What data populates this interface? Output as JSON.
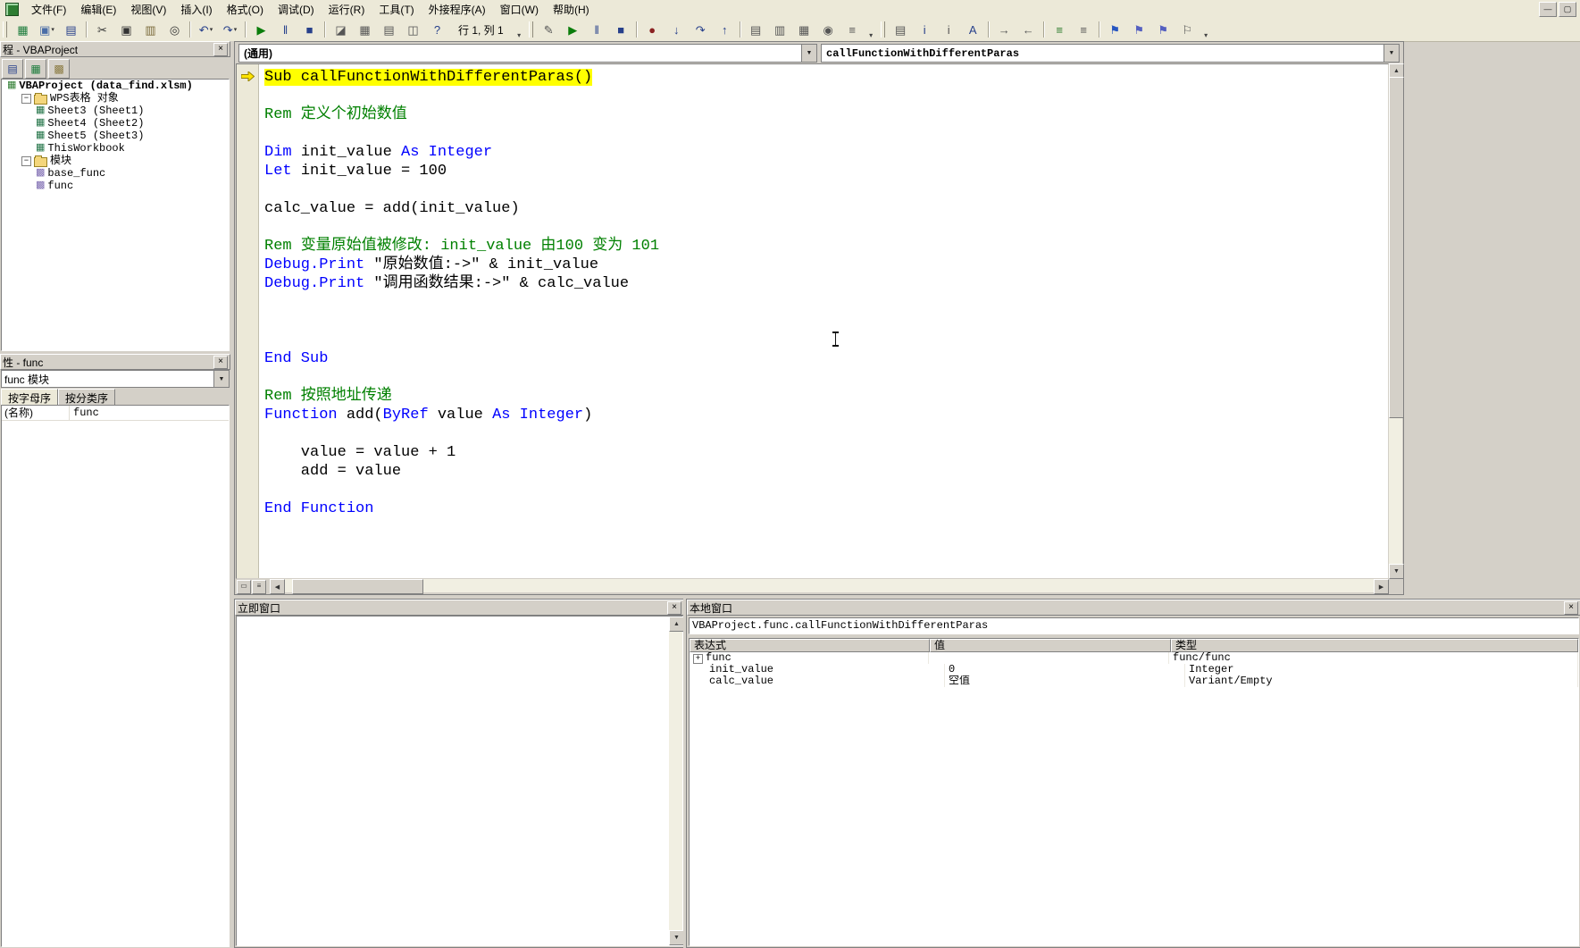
{
  "menu": {
    "items": [
      {
        "name": "menu-file",
        "label": "文件(F)"
      },
      {
        "name": "menu-edit",
        "label": "编辑(E)"
      },
      {
        "name": "menu-view",
        "label": "视图(V)"
      },
      {
        "name": "menu-insert",
        "label": "插入(I)"
      },
      {
        "name": "menu-format",
        "label": "格式(O)"
      },
      {
        "name": "menu-debug",
        "label": "调试(D)"
      },
      {
        "name": "menu-run",
        "label": "运行(R)"
      },
      {
        "name": "menu-tools",
        "label": "工具(T)"
      },
      {
        "name": "menu-addins",
        "label": "外接程序(A)"
      },
      {
        "name": "menu-window",
        "label": "窗口(W)"
      },
      {
        "name": "menu-help",
        "label": "帮助(H)"
      }
    ]
  },
  "window_controls": [
    {
      "name": "minimize-button",
      "glyph": "—"
    },
    {
      "name": "restore-button",
      "glyph": "▢"
    }
  ],
  "toolbar": {
    "groups": [
      {
        "name": "standard",
        "items": [
          {
            "k": "b",
            "name": "view-wps-button",
            "glyph": "▦",
            "color": "#1c7c3c"
          },
          {
            "k": "b",
            "name": "insert-userform-button",
            "glyph": "▣",
            "color": "#4a6da7",
            "dd": true
          },
          {
            "k": "b",
            "name": "save-button",
            "glyph": "▤",
            "color": "#27408b"
          },
          {
            "k": "s"
          },
          {
            "k": "b",
            "name": "cut-button",
            "glyph": "✂",
            "color": "#333333"
          },
          {
            "k": "b",
            "name": "copy-button",
            "glyph": "▣",
            "color": "#333333"
          },
          {
            "k": "b",
            "name": "paste-button",
            "glyph": "▥",
            "color": "#7a6a3a"
          },
          {
            "k": "b",
            "name": "find-button",
            "glyph": "◎",
            "color": "#333333"
          },
          {
            "k": "s"
          },
          {
            "k": "b",
            "name": "undo-button",
            "glyph": "↶",
            "color": "#27408b",
            "dd": true
          },
          {
            "k": "b",
            "name": "redo-button",
            "glyph": "↷",
            "color": "#27408b",
            "dd": true
          },
          {
            "k": "s"
          },
          {
            "k": "b",
            "name": "run-button",
            "glyph": "▶",
            "color": "#0b7d0b"
          },
          {
            "k": "b",
            "name": "break-button",
            "glyph": "‖",
            "color": "#27408b"
          },
          {
            "k": "b",
            "name": "reset-button",
            "glyph": "■",
            "color": "#27408b"
          },
          {
            "k": "s"
          },
          {
            "k": "b",
            "name": "design-mode-button",
            "glyph": "◪",
            "color": "#555555"
          },
          {
            "k": "b",
            "name": "project-explorer-button",
            "glyph": "▦",
            "color": "#555555"
          },
          {
            "k": "b",
            "name": "properties-window-button",
            "glyph": "▤",
            "color": "#555555"
          },
          {
            "k": "b",
            "name": "object-browser-button",
            "glyph": "◫",
            "color": "#555555"
          },
          {
            "k": "b",
            "name": "help-button",
            "glyph": "?",
            "color": "#27408b"
          },
          {
            "k": "t",
            "name": "line-col-indicator",
            "text": "行 1, 列 1"
          },
          {
            "k": "c"
          }
        ]
      },
      {
        "name": "debug",
        "items": [
          {
            "k": "b",
            "name": "debug-design-mode-button",
            "glyph": "✎",
            "color": "#555555"
          },
          {
            "k": "b",
            "name": "debug-run-button",
            "glyph": "▶",
            "color": "#0b7d0b"
          },
          {
            "k": "b",
            "name": "debug-break-button",
            "glyph": "‖",
            "color": "#27408b"
          },
          {
            "k": "b",
            "name": "debug-reset-button",
            "glyph": "■",
            "color": "#27408b"
          },
          {
            "k": "s"
          },
          {
            "k": "b",
            "name": "toggle-breakpoint-button",
            "glyph": "●",
            "color": "#8b2222"
          },
          {
            "k": "b",
            "name": "step-into-button",
            "glyph": "↓",
            "color": "#27408b"
          },
          {
            "k": "b",
            "name": "step-over-button",
            "glyph": "↷",
            "color": "#27408b"
          },
          {
            "k": "b",
            "name": "step-out-button",
            "glyph": "↑",
            "color": "#27408b"
          },
          {
            "k": "s"
          },
          {
            "k": "b",
            "name": "locals-window-button",
            "glyph": "▤",
            "color": "#555555"
          },
          {
            "k": "b",
            "name": "immediate-window-button",
            "glyph": "▥",
            "color": "#555555"
          },
          {
            "k": "b",
            "name": "watch-window-button",
            "glyph": "▦",
            "color": "#555555"
          },
          {
            "k": "b",
            "name": "quick-watch-button",
            "glyph": "◉",
            "color": "#555555"
          },
          {
            "k": "b",
            "name": "call-stack-button",
            "glyph": "≡",
            "color": "#555555"
          },
          {
            "k": "c"
          }
        ]
      },
      {
        "name": "edit",
        "items": [
          {
            "k": "b",
            "name": "list-properties-button",
            "glyph": "▤",
            "color": "#555555"
          },
          {
            "k": "b",
            "name": "quick-info-button",
            "glyph": "i",
            "color": "#27408b"
          },
          {
            "k": "b",
            "name": "parameter-info-button",
            "glyph": "i",
            "color": "#555555"
          },
          {
            "k": "b",
            "name": "complete-word-button",
            "glyph": "A",
            "color": "#27408b"
          },
          {
            "k": "s"
          },
          {
            "k": "b",
            "name": "indent-button",
            "glyph": "→",
            "color": "#555555"
          },
          {
            "k": "b",
            "name": "outdent-button",
            "glyph": "←",
            "color": "#555555"
          },
          {
            "k": "s"
          },
          {
            "k": "b",
            "name": "comment-block-button",
            "glyph": "≡",
            "color": "#2a7a2a"
          },
          {
            "k": "b",
            "name": "uncomment-block-button",
            "glyph": "≡",
            "color": "#555555"
          },
          {
            "k": "s"
          },
          {
            "k": "b",
            "name": "toggle-bookmark-button",
            "glyph": "⚑",
            "color": "#2756c0"
          },
          {
            "k": "b",
            "name": "next-bookmark-button",
            "glyph": "⚑",
            "color": "#5560c0"
          },
          {
            "k": "b",
            "name": "previous-bookmark-button",
            "glyph": "⚑",
            "color": "#5560c0"
          },
          {
            "k": "b",
            "name": "clear-bookmarks-button",
            "glyph": "⚐",
            "color": "#555555"
          },
          {
            "k": "c"
          }
        ]
      }
    ]
  },
  "project_panel": {
    "title": "程 - VBAProject",
    "buttons": [
      {
        "name": "view-code-button",
        "glyph": "▤",
        "color": "#27408b"
      },
      {
        "name": "view-object-button",
        "glyph": "▦",
        "color": "#1c7c3c"
      },
      {
        "name": "toggle-folders-button",
        "glyph": "▩",
        "color": "#8a7a40"
      }
    ],
    "tree": [
      {
        "name": "tree-item-vbaproject-root",
        "label": "VBAProject (data_find.xlsm)",
        "icon": "project",
        "level": 0,
        "bold": true
      },
      {
        "name": "tree-item-wps-objects-folder",
        "label": "WPS表格 对象",
        "icon": "folder",
        "level": 1,
        "expander": "-"
      },
      {
        "name": "tree-item-sheet3",
        "label": "Sheet3 (Sheet1)",
        "icon": "sheet",
        "level": 2
      },
      {
        "name": "tree-item-sheet4",
        "label": "Sheet4 (Sheet2)",
        "icon": "sheet",
        "level": 2
      },
      {
        "name": "tree-item-sheet5",
        "label": "Sheet5 (Sheet3)",
        "icon": "sheet",
        "level": 2
      },
      {
        "name": "tree-item-thisworkbook",
        "label": "ThisWorkbook",
        "icon": "sheet",
        "level": 2
      },
      {
        "name": "tree-item-modules-folder",
        "label": "模块",
        "icon": "folder",
        "level": 1,
        "expander": "-"
      },
      {
        "name": "tree-item-base-func",
        "label": "base_func",
        "icon": "module",
        "level": 2
      },
      {
        "name": "tree-item-func",
        "label": "func",
        "icon": "module",
        "level": 2
      }
    ]
  },
  "properties_panel": {
    "title": "性 - func",
    "object_combo": "func 模块",
    "tabs": [
      {
        "name": "tab-alphabetic",
        "label": "按字母序",
        "active": true
      },
      {
        "name": "tab-categorized",
        "label": "按分类序",
        "active": false
      }
    ],
    "rows": [
      {
        "name": "(名称)",
        "value": "func"
      }
    ]
  },
  "code_window": {
    "left_combo": "(通用)",
    "right_combo": "callFunctionWithDifferentParas",
    "lines": [
      {
        "arrow": true,
        "highlight": true,
        "segments": [
          [
            "Sub callFunctionWithDifferentParas()",
            "p"
          ]
        ]
      },
      {
        "segments": []
      },
      {
        "segments": [
          [
            "Rem 定义个初始数值",
            "c"
          ]
        ]
      },
      {
        "segments": []
      },
      {
        "segments": [
          [
            "Dim ",
            "k"
          ],
          [
            "init_value ",
            "p"
          ],
          [
            "As Integer",
            "k"
          ]
        ]
      },
      {
        "segments": [
          [
            "Let ",
            "k"
          ],
          [
            "init_value = 100",
            "p"
          ]
        ]
      },
      {
        "segments": []
      },
      {
        "segments": [
          [
            "calc_value = add(init_value)",
            "p"
          ]
        ]
      },
      {
        "segments": []
      },
      {
        "segments": [
          [
            "Rem 变量原始值被修改: init_value 由100 变为 101",
            "c"
          ]
        ]
      },
      {
        "segments": [
          [
            "Debug.Print ",
            "k"
          ],
          [
            "\"原始数值:->\" & init_value",
            "p"
          ]
        ]
      },
      {
        "segments": [
          [
            "Debug.Print ",
            "k"
          ],
          [
            "\"调用函数结果:->\" & calc_value",
            "p"
          ]
        ]
      },
      {
        "segments": []
      },
      {
        "segments": []
      },
      {
        "segments": []
      },
      {
        "segments": [
          [
            "End Sub",
            "k"
          ]
        ]
      },
      {
        "segments": []
      },
      {
        "segments": [
          [
            "Rem 按照地址传递",
            "c"
          ]
        ]
      },
      {
        "segments": [
          [
            "Function ",
            "k"
          ],
          [
            "add(",
            "p"
          ],
          [
            "ByRef ",
            "k"
          ],
          [
            "value ",
            "p"
          ],
          [
            "As Integer",
            "k"
          ],
          [
            ")",
            "p"
          ]
        ]
      },
      {
        "segments": []
      },
      {
        "segments": [
          [
            "    value = value + 1",
            "p"
          ]
        ]
      },
      {
        "segments": [
          [
            "    add = value",
            "p"
          ]
        ]
      },
      {
        "segments": []
      },
      {
        "segments": [
          [
            "End Function",
            "k"
          ]
        ]
      }
    ]
  },
  "immediate_window": {
    "title": "立即窗口"
  },
  "locals_window": {
    "title": "本地窗口",
    "context": "VBAProject.func.callFunctionWithDifferentParas",
    "columns": [
      "表达式",
      "值",
      "类型"
    ],
    "rows": [
      {
        "name": "locals-row-func",
        "expand": "+",
        "level": 0,
        "expr": "func",
        "value": "",
        "type": "func/func"
      },
      {
        "name": "locals-row-init-value",
        "level": 1,
        "expr": "init_value",
        "value": "0",
        "type": "Integer"
      },
      {
        "name": "locals-row-calc-value",
        "level": 1,
        "expr": "calc_value",
        "value": "空值",
        "type": "Variant/Empty"
      }
    ]
  }
}
